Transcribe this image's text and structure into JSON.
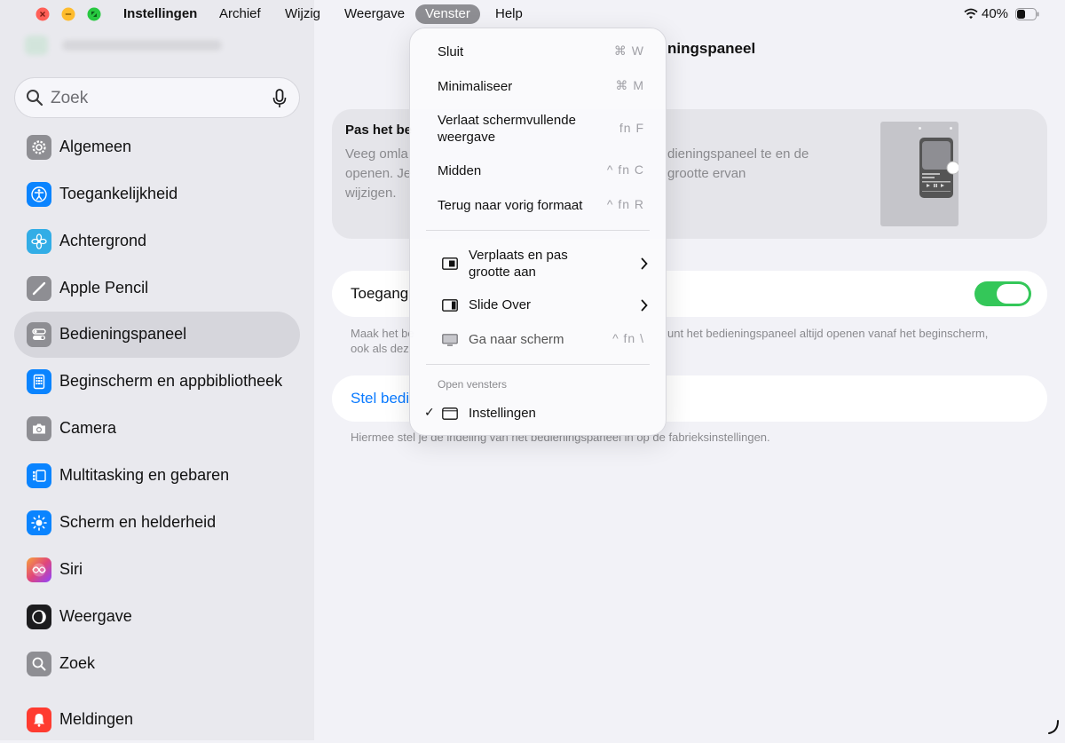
{
  "menubar": {
    "app_name": "Instellingen",
    "menus": [
      "Archief",
      "Wijzig",
      "Weergave",
      "Venster",
      "Help"
    ],
    "active_menu": "Venster",
    "battery_percent": "40%",
    "traffic_colors": {
      "close": "#ff5f57",
      "minimize": "#febc2e",
      "zoom": "#28c840"
    }
  },
  "sidebar": {
    "search_placeholder": "Zoek",
    "items": [
      {
        "label": "Algemeen",
        "icon": "gear-icon",
        "color": "#8e8e93"
      },
      {
        "label": "Toegankelijkheid",
        "icon": "accessibility-icon",
        "color": "#0a84ff"
      },
      {
        "label": "Achtergrond",
        "icon": "flower-icon",
        "color": "#32ade6"
      },
      {
        "label": "Apple Pencil",
        "icon": "pencil-icon",
        "color": "#8e8e93"
      },
      {
        "label": "Bedieningspaneel",
        "icon": "toggles-icon",
        "color": "#8e8e93",
        "selected": true
      },
      {
        "label": "Beginscherm en appbibliotheek",
        "icon": "home-grid-icon",
        "color": "#0a84ff"
      },
      {
        "label": "Camera",
        "icon": "camera-icon",
        "color": "#8e8e93"
      },
      {
        "label": "Multitasking en gebaren",
        "icon": "multitasking-icon",
        "color": "#0a84ff"
      },
      {
        "label": "Scherm en helderheid",
        "icon": "sun-icon",
        "color": "#0a84ff"
      },
      {
        "label": "Siri",
        "icon": "siri-icon",
        "color": "#d04bd9"
      },
      {
        "label": "Weergave",
        "icon": "standby-icon",
        "color": "#1c1c1e"
      },
      {
        "label": "Zoek",
        "icon": "search-icon",
        "color": "#8e8e93"
      },
      {
        "label": "Meldingen",
        "icon": "bell-icon",
        "color": "#ff3b30"
      }
    ]
  },
  "main": {
    "title_fragment": "ningspaneel",
    "card1": {
      "title": "Pas het be",
      "desc_left": "Veeg omla openen. Je wijzigen.",
      "desc_right": "dieningspaneel te en de grootte ervan"
    },
    "toggle_row": {
      "label": "Toegang",
      "enabled": true
    },
    "toggle_note_left": "Maak het be",
    "toggle_note_left2": "ook als dez",
    "toggle_note_right": "unt het bedieningspaneel altijd openen vanaf het beginscherm,",
    "reset_row": {
      "label": "Stel bedi"
    },
    "reset_note": "Hiermee stel je de indeling van het bedieningspaneel in op de fabrieksinstellingen."
  },
  "dropdown": {
    "items": [
      {
        "label": "Sluit",
        "shortcut": "⌘ W"
      },
      {
        "label": "Minimaliseer",
        "shortcut": "⌘ M"
      },
      {
        "label": "Verlaat schermvullende",
        "label2": "weergave",
        "shortcut": "fn F"
      },
      {
        "label": "Midden",
        "shortcut": "^ fn C"
      },
      {
        "label": "Terug naar vorig formaat",
        "shortcut": "^ fn R"
      }
    ],
    "submenus": [
      {
        "label": "Verplaats en pas",
        "label2": "grootte aan",
        "icon": "window-resize-icon"
      },
      {
        "label": "Slide Over",
        "icon": "slide-over-icon"
      }
    ],
    "display_item": {
      "label": "Ga naar scherm",
      "shortcut": "^ fn \\",
      "icon": "display-icon"
    },
    "section_header": "Open vensters",
    "open_window": {
      "label": "Instellingen",
      "checked": true,
      "icon": "window-icon"
    }
  }
}
